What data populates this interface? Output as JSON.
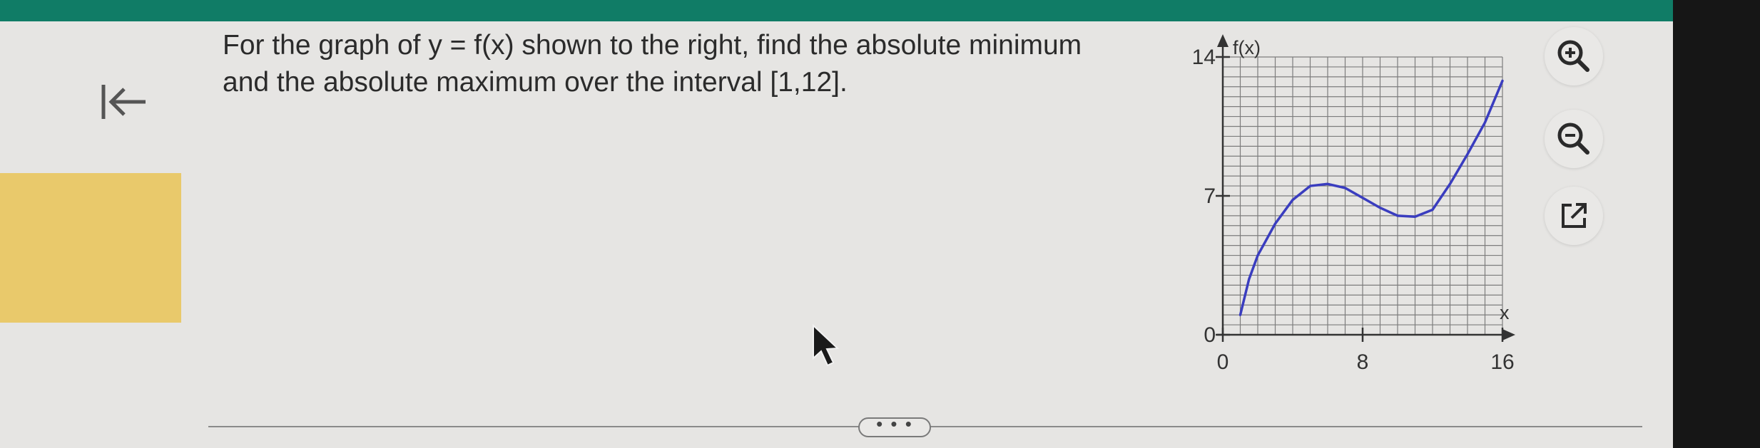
{
  "question": {
    "line1": "For the graph of y = f(x) shown to the right, find the absolute minimum",
    "line2": "and the absolute maximum over the interval [1,12]."
  },
  "graph": {
    "y_axis_label": "f(x)",
    "x_axis_label": "x",
    "y_ticks": [
      "14",
      "7",
      "0"
    ],
    "x_ticks": [
      "0",
      "8",
      "16"
    ],
    "x_range": [
      0,
      16
    ],
    "y_range": [
      0,
      14
    ],
    "grid": true,
    "curve_color": "#3a3dbf",
    "curve_points": [
      [
        1,
        1.0
      ],
      [
        1.5,
        2.8
      ],
      [
        2,
        4.0
      ],
      [
        3,
        5.6
      ],
      [
        4,
        6.8
      ],
      [
        5,
        7.5
      ],
      [
        6,
        7.6
      ],
      [
        7,
        7.4
      ],
      [
        8,
        6.9
      ],
      [
        9,
        6.4
      ],
      [
        10,
        6.0
      ],
      [
        11,
        5.95
      ],
      [
        12,
        6.3
      ],
      [
        13,
        7.6
      ],
      [
        14,
        9.1
      ],
      [
        15,
        10.7
      ],
      [
        16,
        12.8
      ]
    ]
  },
  "toolbar": {
    "zoom_in_icon": "zoom-in-icon",
    "zoom_out_icon": "zoom-out-icon",
    "popout_icon": "external-link-icon"
  },
  "more": {
    "label": "• • •"
  },
  "nav": {
    "collapse_icon": "arrow-left-to-bar-icon"
  },
  "colors": {
    "top_bar": "#107c66",
    "side_panel": "#e9c96b",
    "background": "#e6e5e3"
  }
}
